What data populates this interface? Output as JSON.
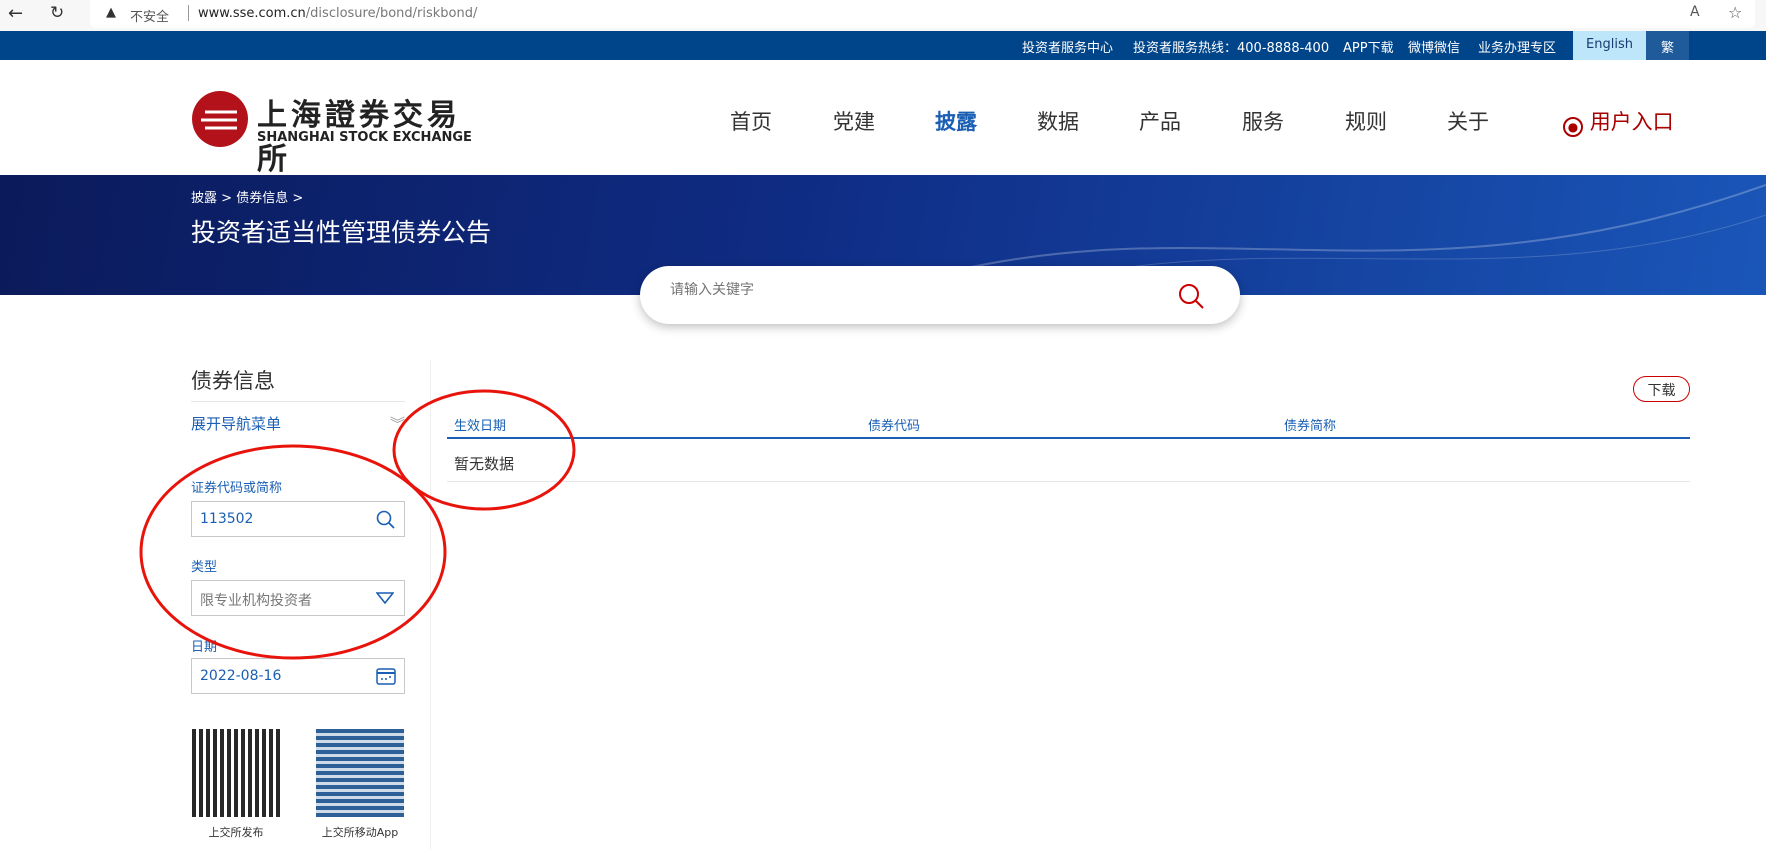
{
  "browser": {
    "security": "不安全",
    "url_host": "www.sse.com.cn",
    "url_path": "/disclosure/bond/riskbond/"
  },
  "topbar": {
    "items": [
      "投资者服务中心",
      "投资者服务热线：400-8888-400",
      "APP下载",
      "微博微信",
      "业务办理专区"
    ],
    "english": "English",
    "traditional": "繁"
  },
  "logo": {
    "cn": "上海證券交易所",
    "en": "SHANGHAI STOCK EXCHANGE"
  },
  "nav": {
    "items": [
      "首页",
      "党建",
      "披露",
      "数据",
      "产品",
      "服务",
      "规则",
      "关于"
    ],
    "active": "披露",
    "user": "用户入口"
  },
  "banner": {
    "breadcrumb": [
      "披露",
      "债券信息"
    ],
    "title": "投资者适当性管理债券公告"
  },
  "search": {
    "placeholder": "请输入关键字"
  },
  "sidebar": {
    "title": "债券信息",
    "expand": "展开导航菜单",
    "code_label": "证券代码或简称",
    "code_value": "113502",
    "type_label": "类型",
    "type_value": "限专业机构投资者",
    "date_label": "日期",
    "date_value": "2022-08-16",
    "qr": [
      "上交所发布",
      "上交所移动App"
    ]
  },
  "table": {
    "download": "下载",
    "columns": [
      "生效日期",
      "债券代码",
      "债券简称"
    ],
    "empty": "暂无数据"
  },
  "colors": {
    "brand_blue": "#00448a",
    "accent": "#1a5fb4",
    "red": "#c00000"
  }
}
